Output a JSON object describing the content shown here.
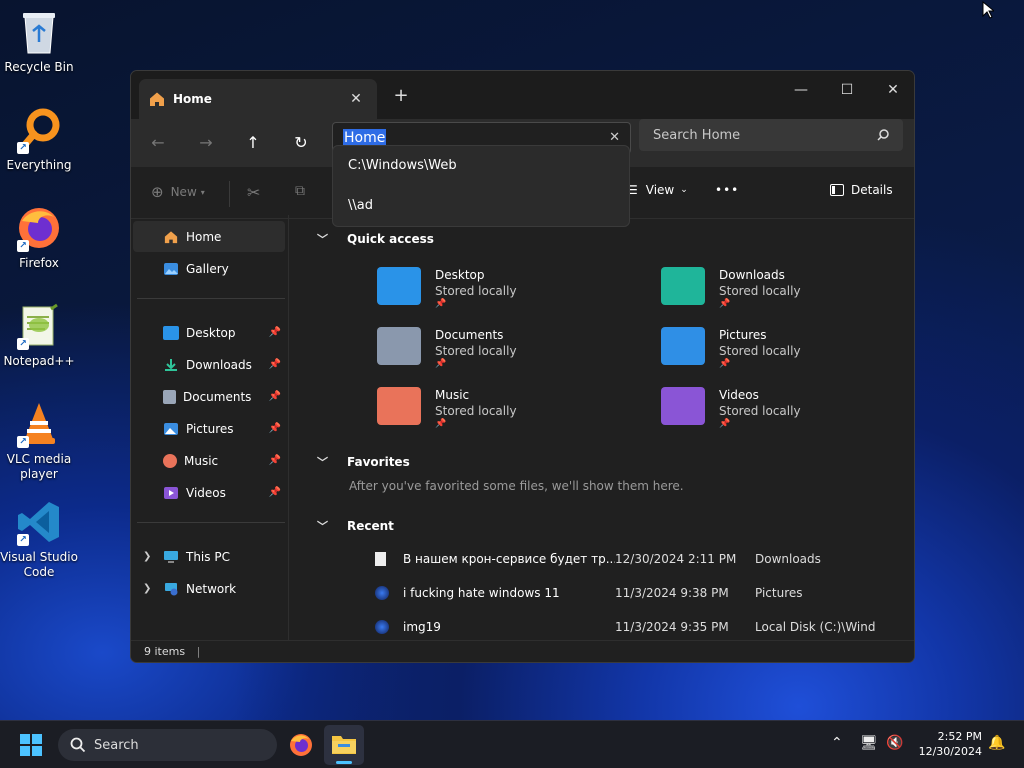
{
  "desktop": {
    "icons": [
      {
        "label": "Recycle Bin"
      },
      {
        "label": "Everything"
      },
      {
        "label": "Firefox"
      },
      {
        "label": "Notepad++"
      },
      {
        "label": "VLC media player"
      },
      {
        "label": "Visual Studio Code"
      }
    ]
  },
  "window": {
    "tab_title": "Home",
    "tab_close": "✕",
    "new_tab": "+",
    "controls": {
      "minimize": "—",
      "maximize": "☐",
      "close": "✕"
    },
    "nav": {
      "back": "←",
      "forward": "→",
      "up": "↑",
      "refresh": "↻"
    },
    "address": {
      "value": "Home",
      "clear": "✕"
    },
    "search": {
      "placeholder": "Search Home"
    },
    "address_suggestions": [
      "C:\\Windows\\Web",
      "\\\\ad"
    ],
    "commands": {
      "new": "New",
      "view": "View",
      "more": "•••",
      "details": "Details"
    },
    "sidebar": {
      "top": [
        {
          "label": "Home",
          "active": true
        },
        {
          "label": "Gallery"
        }
      ],
      "pinned": [
        {
          "label": "Desktop"
        },
        {
          "label": "Downloads"
        },
        {
          "label": "Documents"
        },
        {
          "label": "Pictures"
        },
        {
          "label": "Music"
        },
        {
          "label": "Videos"
        }
      ],
      "drives": [
        {
          "label": "This PC"
        },
        {
          "label": "Network"
        }
      ]
    },
    "quick_access": {
      "title": "Quick access",
      "items": [
        {
          "name": "Desktop",
          "sub": "Stored locally",
          "color": "#2a93e8"
        },
        {
          "name": "Downloads",
          "sub": "Stored locally",
          "color": "#1fb59a"
        },
        {
          "name": "Documents",
          "sub": "Stored locally",
          "color": "#8a98ad"
        },
        {
          "name": "Pictures",
          "sub": "Stored locally",
          "color": "#2f8fe6"
        },
        {
          "name": "Music",
          "sub": "Stored locally",
          "color": "#e9735a"
        },
        {
          "name": "Videos",
          "sub": "Stored locally",
          "color": "#8a55d6"
        }
      ]
    },
    "favorites": {
      "title": "Favorites",
      "empty_text": "After you've favorited some files, we'll show them here."
    },
    "recent": {
      "title": "Recent",
      "rows": [
        {
          "name": "В нашем крон-сервисе будет тр...",
          "date": "12/30/2024 2:11 PM",
          "location": "Downloads"
        },
        {
          "name": "i fucking hate windows 11",
          "date": "11/3/2024 9:38 PM",
          "location": "Pictures"
        },
        {
          "name": "img19",
          "date": "11/3/2024 9:35 PM",
          "location": "Local Disk (C:)\\Wind..."
        }
      ]
    },
    "status": {
      "items": "9 items"
    }
  },
  "taskbar": {
    "search_label": "Search",
    "time": "2:52 PM",
    "date": "12/30/2024"
  }
}
